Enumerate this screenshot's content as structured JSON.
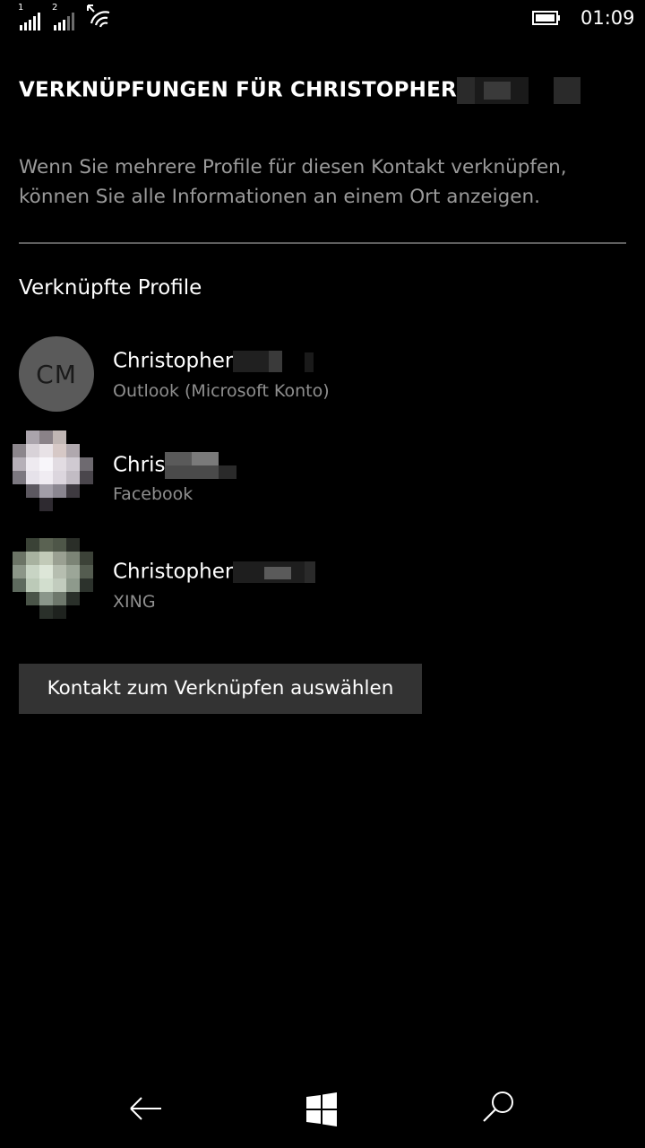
{
  "status": {
    "sim1": "1",
    "sim2": "2",
    "time": "01:09",
    "icons": [
      "signal-icon",
      "signal-icon",
      "wifi-icon",
      "battery-icon"
    ]
  },
  "page": {
    "title": "VERKNÜPFUNGEN FÜR CHRISTOPHER",
    "description": "Wenn Sie mehrere Profile für diesen Kontakt verknüpfen, können Sie alle Informationen an einem Ort anzeigen.",
    "section_label": "Verknüpfte Profile"
  },
  "profiles": [
    {
      "initials": "CM",
      "name": "Christopher",
      "source": "Outlook (Microsoft Konto)"
    },
    {
      "name": "Chris",
      "source": "Facebook"
    },
    {
      "name": "Christopher",
      "source": "XING"
    }
  ],
  "actions": {
    "select_contact": "Kontakt zum Verknüpfen auswählen"
  },
  "nav": {
    "icons": [
      "back-arrow-icon",
      "windows-logo-icon",
      "search-icon"
    ]
  }
}
